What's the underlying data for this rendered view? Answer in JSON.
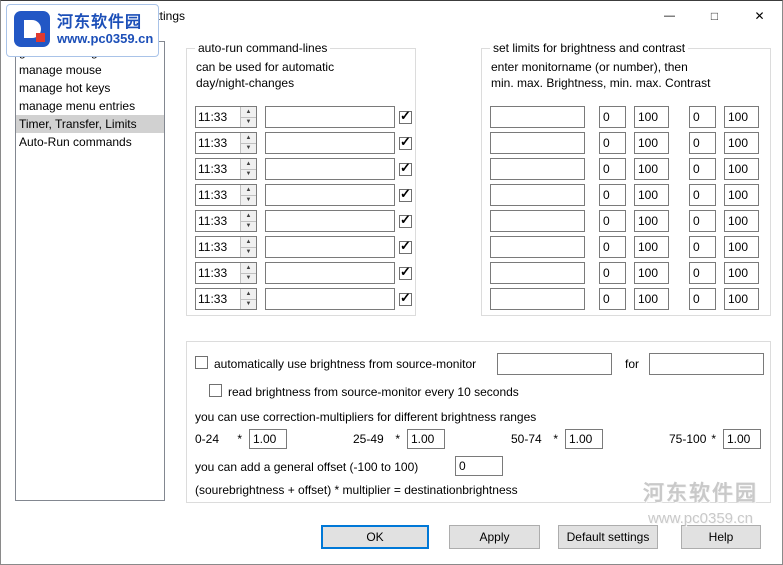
{
  "window": {
    "title": "ClickMonitorDDC - Settings"
  },
  "icons": {
    "minimize": "—",
    "maximize": "□",
    "close": "✕",
    "check": "✓",
    "spin_up": "▲",
    "spin_down": "▼"
  },
  "watermark_top": {
    "site_name": "河东软件园",
    "url": "www.pc0359.cn"
  },
  "watermark_bottom": {
    "site_name": "河东软件园",
    "url": "www.pc0359.cn"
  },
  "sidebar": {
    "items": [
      {
        "label": "general settings",
        "selected": false
      },
      {
        "label": "manage mouse",
        "selected": false
      },
      {
        "label": "manage hot keys",
        "selected": false
      },
      {
        "label": "manage menu entries",
        "selected": false
      },
      {
        "label": "Timer, Transfer, Limits",
        "selected": true
      },
      {
        "label": "Auto-Run commands",
        "selected": false
      }
    ]
  },
  "autorun_group": {
    "title": "auto-run command-lines",
    "description_line1": "can be used for automatic",
    "description_line2": "day/night-changes",
    "rows": [
      {
        "time": "11:33",
        "command": "",
        "enabled": true
      },
      {
        "time": "11:33",
        "command": "",
        "enabled": true
      },
      {
        "time": "11:33",
        "command": "",
        "enabled": true
      },
      {
        "time": "11:33",
        "command": "",
        "enabled": true
      },
      {
        "time": "11:33",
        "command": "",
        "enabled": true
      },
      {
        "time": "11:33",
        "command": "",
        "enabled": true
      },
      {
        "time": "11:33",
        "command": "",
        "enabled": true
      },
      {
        "time": "11:33",
        "command": "",
        "enabled": true
      }
    ]
  },
  "limits_group": {
    "title": "set limits for brightness and contrast",
    "description_line1": "enter monitorname (or number), then",
    "description_line2": "min. max. Brightness, min. max. Contrast",
    "rows": [
      {
        "monitor": "",
        "min_brightness": "0",
        "max_brightness": "100",
        "min_contrast": "0",
        "max_contrast": "100"
      },
      {
        "monitor": "",
        "min_brightness": "0",
        "max_brightness": "100",
        "min_contrast": "0",
        "max_contrast": "100"
      },
      {
        "monitor": "",
        "min_brightness": "0",
        "max_brightness": "100",
        "min_contrast": "0",
        "max_contrast": "100"
      },
      {
        "monitor": "",
        "min_brightness": "0",
        "max_brightness": "100",
        "min_contrast": "0",
        "max_contrast": "100"
      },
      {
        "monitor": "",
        "min_brightness": "0",
        "max_brightness": "100",
        "min_contrast": "0",
        "max_contrast": "100"
      },
      {
        "monitor": "",
        "min_brightness": "0",
        "max_brightness": "100",
        "min_contrast": "0",
        "max_contrast": "100"
      },
      {
        "monitor": "",
        "min_brightness": "0",
        "max_brightness": "100",
        "min_contrast": "0",
        "max_contrast": "100"
      },
      {
        "monitor": "",
        "min_brightness": "0",
        "max_brightness": "100",
        "min_contrast": "0",
        "max_contrast": "100"
      }
    ]
  },
  "transfer_group": {
    "auto_brightness_label": "automatically use brightness from source-monitor",
    "auto_brightness_checked": false,
    "source_value": "",
    "for_label": "for",
    "dest_value": "",
    "read_brightness_label": "read brightness from source-monitor every 10 seconds",
    "read_brightness_checked": false,
    "multipliers_heading": "you can use correction-multipliers for different brightness ranges",
    "multipliers": [
      {
        "range": "0-24",
        "op": "*",
        "value": "1.00"
      },
      {
        "range": "25-49",
        "op": "*",
        "value": "1.00"
      },
      {
        "range": "50-74",
        "op": "*",
        "value": "1.00"
      },
      {
        "range": "75-100",
        "op": "*",
        "value": "1.00"
      }
    ],
    "offset_label": "you can add a general offset (-100 to 100)",
    "offset_value": "0",
    "formula": "(sourebrightness + offset) * multiplier = destinationbrightness"
  },
  "buttons": {
    "ok": "OK",
    "apply": "Apply",
    "defaults": "Default settings",
    "help": "Help"
  }
}
